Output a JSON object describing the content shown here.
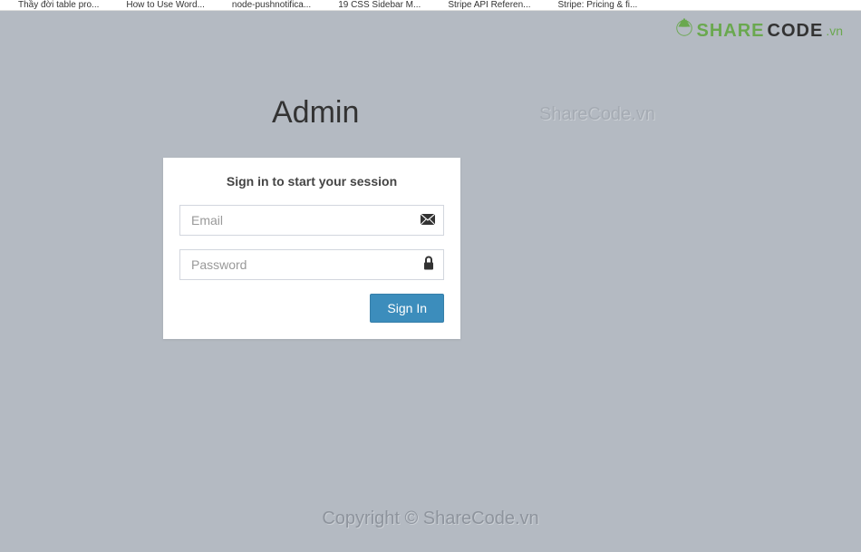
{
  "bookmarks": {
    "item1": "Thầy đời table pro...",
    "item2": "How to Use Word...",
    "item3": "node-pushnotifica...",
    "item4": "19 CSS Sidebar M...",
    "item5": "Stripe API Referen...",
    "item6": "Stripe: Pricing & fi..."
  },
  "logo": {
    "share": "SHARE",
    "code": "CODE",
    "vn": ".vn"
  },
  "watermark_mid": "ShareCode.vn",
  "title": "Admin",
  "login": {
    "message": "Sign in to start your session",
    "email_placeholder": "Email",
    "password_placeholder": "Password",
    "button": "Sign In"
  },
  "footer": "Copyright © ShareCode.vn"
}
